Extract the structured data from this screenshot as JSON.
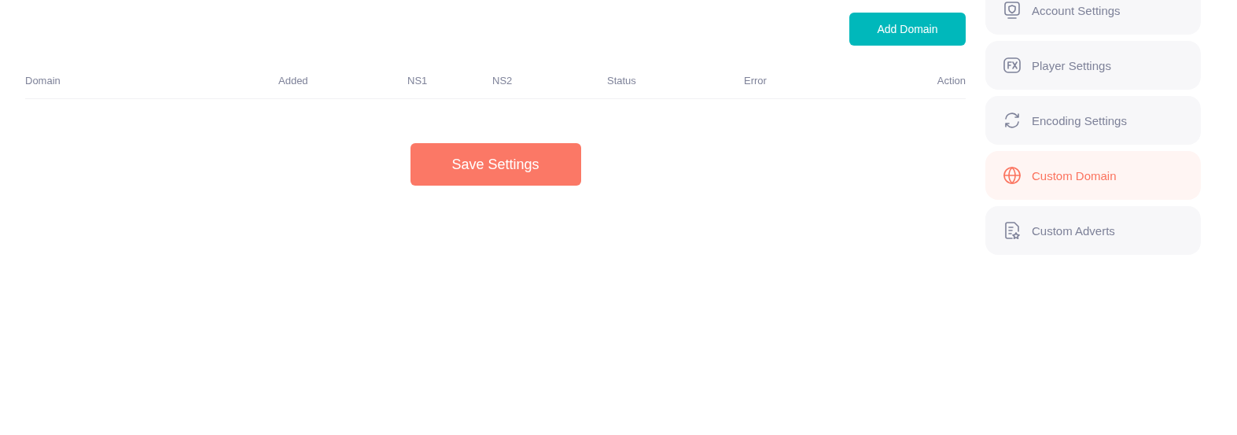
{
  "toolbar": {
    "add_button": "Add Domain"
  },
  "table": {
    "columns": [
      {
        "label": "Domain"
      },
      {
        "label": "Added"
      },
      {
        "label": "NS1"
      },
      {
        "label": "NS2"
      },
      {
        "label": "Status"
      },
      {
        "label": "Error"
      },
      {
        "label": "Action"
      }
    ]
  },
  "save_button": "Save Settings",
  "sidebar": {
    "items": [
      {
        "label": "Account Settings",
        "selected": false
      },
      {
        "label": "Player Settings",
        "selected": false
      },
      {
        "label": "Encoding Settings",
        "selected": false
      },
      {
        "label": "Custom Domain",
        "selected": true
      },
      {
        "label": "Custom Adverts",
        "selected": false
      }
    ]
  }
}
